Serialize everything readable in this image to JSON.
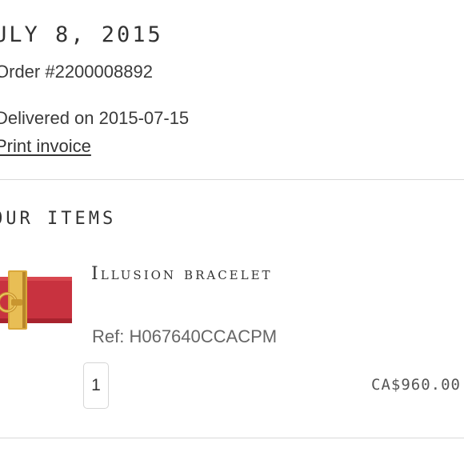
{
  "order": {
    "date": "ULY 8, 2015",
    "number": "Order #2200008892",
    "delivery_status": "Delivered on 2015-07-15",
    "print_invoice_label": "Print invoice"
  },
  "items_section": {
    "title": "OUR ITEMS",
    "items": [
      {
        "name": "Illusion bracelet",
        "ref": "Ref: H067640CCACPM",
        "quantity": "1",
        "price": "CA$960.00",
        "image_icon": "red-leather-bracelet-gold-clasp"
      }
    ]
  },
  "colors": {
    "text": "#333333",
    "muted": "#666666",
    "divider": "#d9d9d9",
    "bracelet_red": "#c8323f",
    "clasp_gold": "#d9a83a"
  }
}
